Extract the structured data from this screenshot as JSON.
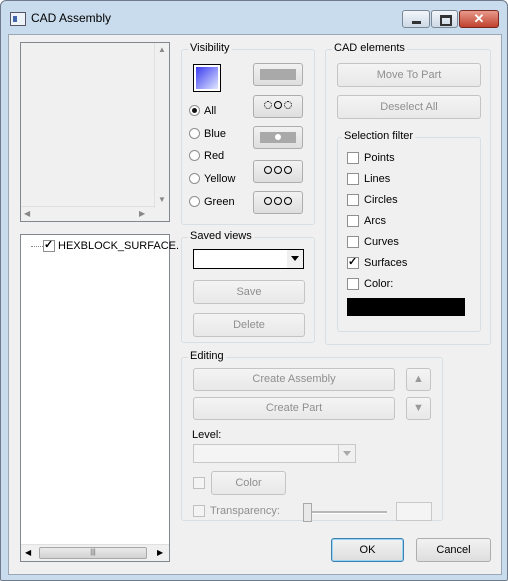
{
  "window": {
    "title": "CAD Assembly"
  },
  "tree": {
    "item_label": "HEXBLOCK_SURFACE."
  },
  "visibility": {
    "label": "Visibility",
    "radios": [
      {
        "label": "All",
        "checked": true
      },
      {
        "label": "Blue",
        "checked": false
      },
      {
        "label": "Red",
        "checked": false
      },
      {
        "label": "Yellow",
        "checked": false
      },
      {
        "label": "Green",
        "checked": false
      }
    ]
  },
  "saved_views": {
    "label": "Saved views",
    "save_label": "Save",
    "delete_label": "Delete"
  },
  "cad_elements": {
    "label": "CAD elements",
    "move_to_part_label": "Move To Part",
    "deselect_all_label": "Deselect All"
  },
  "selection_filter": {
    "label": "Selection filter",
    "items": [
      {
        "label": "Points",
        "checked": false
      },
      {
        "label": "Lines",
        "checked": false
      },
      {
        "label": "Circles",
        "checked": false
      },
      {
        "label": "Arcs",
        "checked": false
      },
      {
        "label": "Curves",
        "checked": false
      },
      {
        "label": "Surfaces",
        "checked": true
      },
      {
        "label": "Color:",
        "checked": false
      }
    ],
    "color_swatch": "#000000"
  },
  "editing": {
    "label": "Editing",
    "create_assembly_label": "Create Assembly",
    "create_part_label": "Create Part",
    "level_label": "Level:",
    "color_label": "Color",
    "transparency_label": "Transparency:"
  },
  "dialog": {
    "ok_label": "OK",
    "cancel_label": "Cancel"
  },
  "colors": {
    "accent_gradient_start": "#3a3af0",
    "accent_gradient_end": "#e0e8ff"
  }
}
